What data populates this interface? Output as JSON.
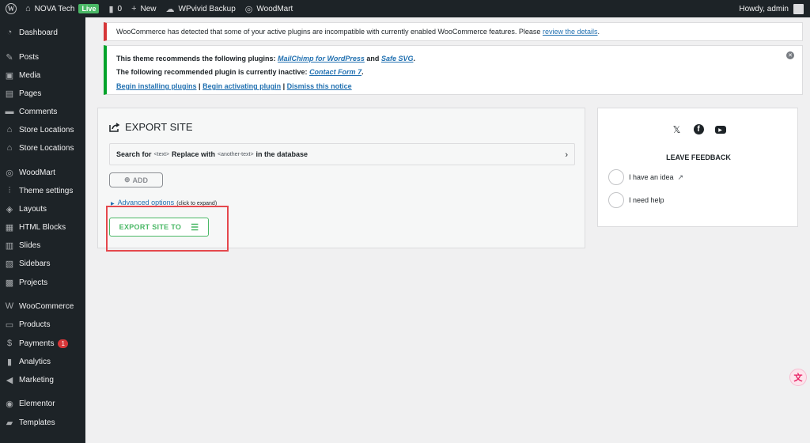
{
  "admin_bar": {
    "site_name": "NOVA Tech",
    "live_badge": "Live",
    "comments_count": "0",
    "new_label": "New",
    "backup_label": "WPvivid Backup",
    "woodmart_label": "WoodMart",
    "howdy": "Howdy, admin"
  },
  "sidebar": {
    "items": [
      {
        "label": "Dashboard",
        "icon": "dashboard-icon"
      },
      {
        "label": "Posts",
        "icon": "pin-icon"
      },
      {
        "label": "Media",
        "icon": "media-icon"
      },
      {
        "label": "Pages",
        "icon": "page-icon"
      },
      {
        "label": "Comments",
        "icon": "comment-icon"
      },
      {
        "label": "Store Locations",
        "icon": "store-icon"
      },
      {
        "label": "Store Locations",
        "icon": "store-icon"
      },
      {
        "label": "WoodMart",
        "icon": "woodmart-icon"
      },
      {
        "label": "Theme settings",
        "icon": "settings-icon"
      },
      {
        "label": "Layouts",
        "icon": "layers-icon"
      },
      {
        "label": "HTML Blocks",
        "icon": "html-icon"
      },
      {
        "label": "Slides",
        "icon": "slides-icon"
      },
      {
        "label": "Sidebars",
        "icon": "sidebar-icon"
      },
      {
        "label": "Projects",
        "icon": "briefcase-icon"
      },
      {
        "label": "WooCommerce",
        "icon": "woo-icon"
      },
      {
        "label": "Products",
        "icon": "products-icon"
      },
      {
        "label": "Payments",
        "icon": "dollar-icon",
        "badge": "1"
      },
      {
        "label": "Analytics",
        "icon": "chart-icon"
      },
      {
        "label": "Marketing",
        "icon": "megaphone-icon"
      },
      {
        "label": "Elementor",
        "icon": "elementor-icon"
      },
      {
        "label": "Templates",
        "icon": "folder-icon"
      }
    ]
  },
  "notices": {
    "error": {
      "text": "WooCommerce has detected that some of your active plugins are incompatible with currently enabled WooCommerce features. Please",
      "link": "review the details",
      "end": "."
    },
    "plugins": {
      "line1_prefix": "This theme recommends the following plugins:",
      "plugin1": "MailChimp for WordPress",
      "and": "and",
      "plugin2": "Safe SVG",
      "period": ".",
      "line2_prefix": "The following recommended plugin is currently inactive:",
      "plugin3": "Contact Form 7",
      "action1": "Begin installing plugins",
      "sep": "|",
      "action2": "Begin activating plugin",
      "action3": "Dismiss this notice"
    }
  },
  "export": {
    "title": "EXPORT SITE",
    "search_for": "Search for",
    "text_placeholder": "<text>",
    "replace_with": "Replace with",
    "another_placeholder": "<another-text>",
    "in_db": "in the database",
    "add_label": "ADD",
    "advanced_label": "Advanced options",
    "advanced_hint": "(click to expand)",
    "export_button": "EXPORT SITE TO"
  },
  "feedback": {
    "title": "LEAVE FEEDBACK",
    "option1": "I have an idea",
    "option2": "I need help"
  },
  "colors": {
    "accent_green": "#4ab866",
    "error_red": "#d63638",
    "link_blue": "#2271b1",
    "highlight": "#e5484d"
  }
}
